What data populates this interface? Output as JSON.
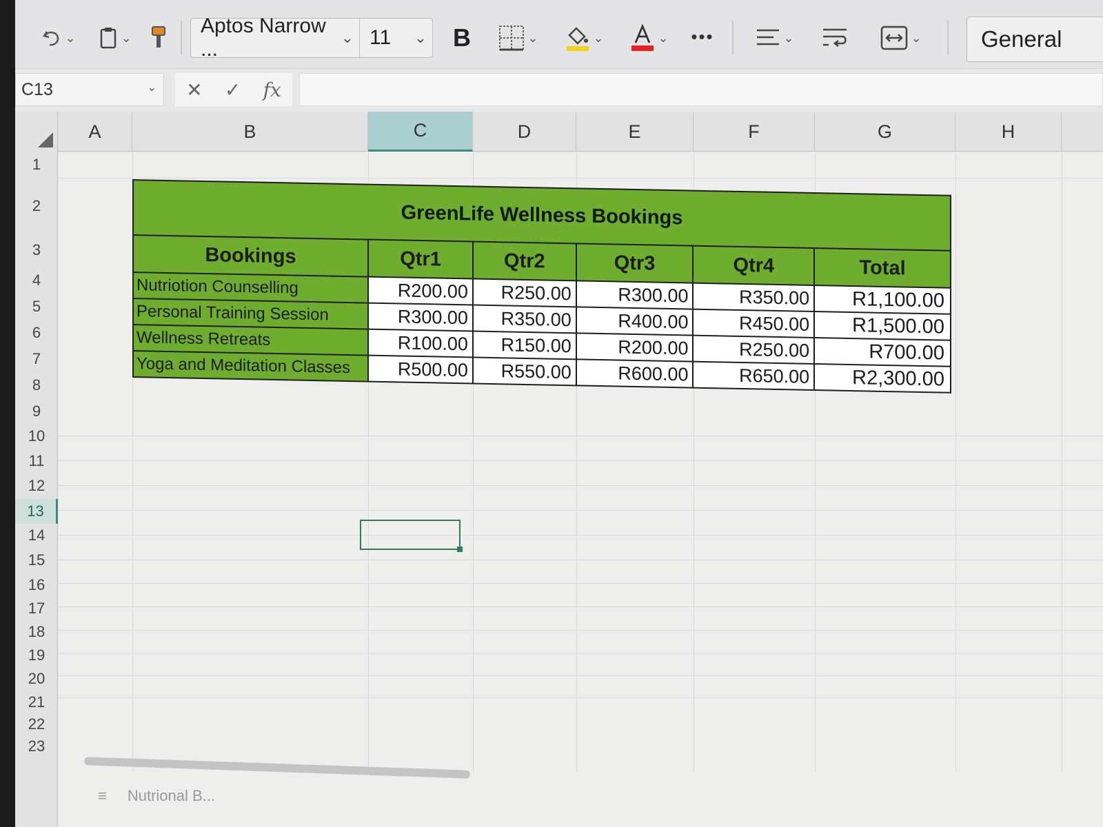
{
  "toolbar": {
    "font_name": "Aptos Narrow ...",
    "font_size": "11",
    "bold_label": "B",
    "more_label": "•••",
    "number_format": "General"
  },
  "formula_bar": {
    "name_box": "C13",
    "cancel": "✕",
    "enter": "✓",
    "fx": "fx",
    "value": ""
  },
  "columns": [
    "A",
    "B",
    "C",
    "D",
    "E",
    "F",
    "G",
    "H"
  ],
  "selected_column": "C",
  "rows": [
    "1",
    "2",
    "3",
    "4",
    "5",
    "6",
    "7",
    "8",
    "9",
    "10",
    "11",
    "12",
    "13",
    "14",
    "15",
    "16",
    "17",
    "18",
    "19",
    "20",
    "21",
    "22",
    "23"
  ],
  "selected_row": "13",
  "table": {
    "title": "GreenLife Wellness Bookings",
    "headers": [
      "Bookings",
      "Qtr1",
      "Qtr2",
      "Qtr3",
      "Qtr4",
      "Total"
    ],
    "rows": [
      {
        "label": "Nutriotion Counselling",
        "values": [
          "R200.00",
          "R250.00",
          "R300.00",
          "R350.00"
        ],
        "total": "R1,100.00"
      },
      {
        "label": "Personal Training Session",
        "values": [
          "R300.00",
          "R350.00",
          "R400.00",
          "R450.00"
        ],
        "total": "R1,500.00"
      },
      {
        "label": "Wellness Retreats",
        "values": [
          "R100.00",
          "R150.00",
          "R200.00",
          "R250.00"
        ],
        "total": "R700.00"
      },
      {
        "label": "Yoga and Meditation Classes",
        "values": [
          "R500.00",
          "R550.00",
          "R600.00",
          "R650.00"
        ],
        "total": "R2,300.00"
      }
    ]
  },
  "sheet_tab": "Nutrional B...",
  "colors": {
    "header_green": "#6fad2e",
    "selection_green": "#2f7d57",
    "selected_col_bg": "#a9cfcf"
  },
  "icons": [
    "undo-icon",
    "clipboard-icon",
    "format-painter-icon",
    "borders-icon",
    "fill-color-icon",
    "font-color-icon",
    "align-icon",
    "wrap-text-icon",
    "merge-icon"
  ]
}
